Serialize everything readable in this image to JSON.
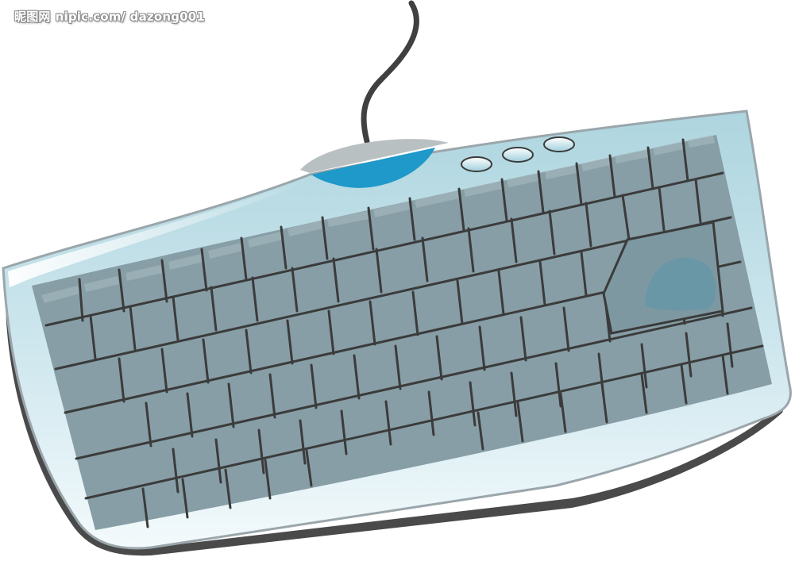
{
  "watermark": {
    "brand": "昵图网",
    "site": "nipic.com/ dazong001"
  },
  "illustration": {
    "subject": "keyboard",
    "colors": {
      "body": "#bfe0e8",
      "body_edge": "#9aa6ab",
      "shadow": "#4a4a4a",
      "keys": "#879ea6",
      "key_lines": "#3b3b3b",
      "cable": "#404040",
      "hub_grey": "#b9c0c2",
      "hub_blue": "#1e99c9",
      "trackpad_blob": "#6a97a6"
    },
    "media_buttons": 3
  }
}
